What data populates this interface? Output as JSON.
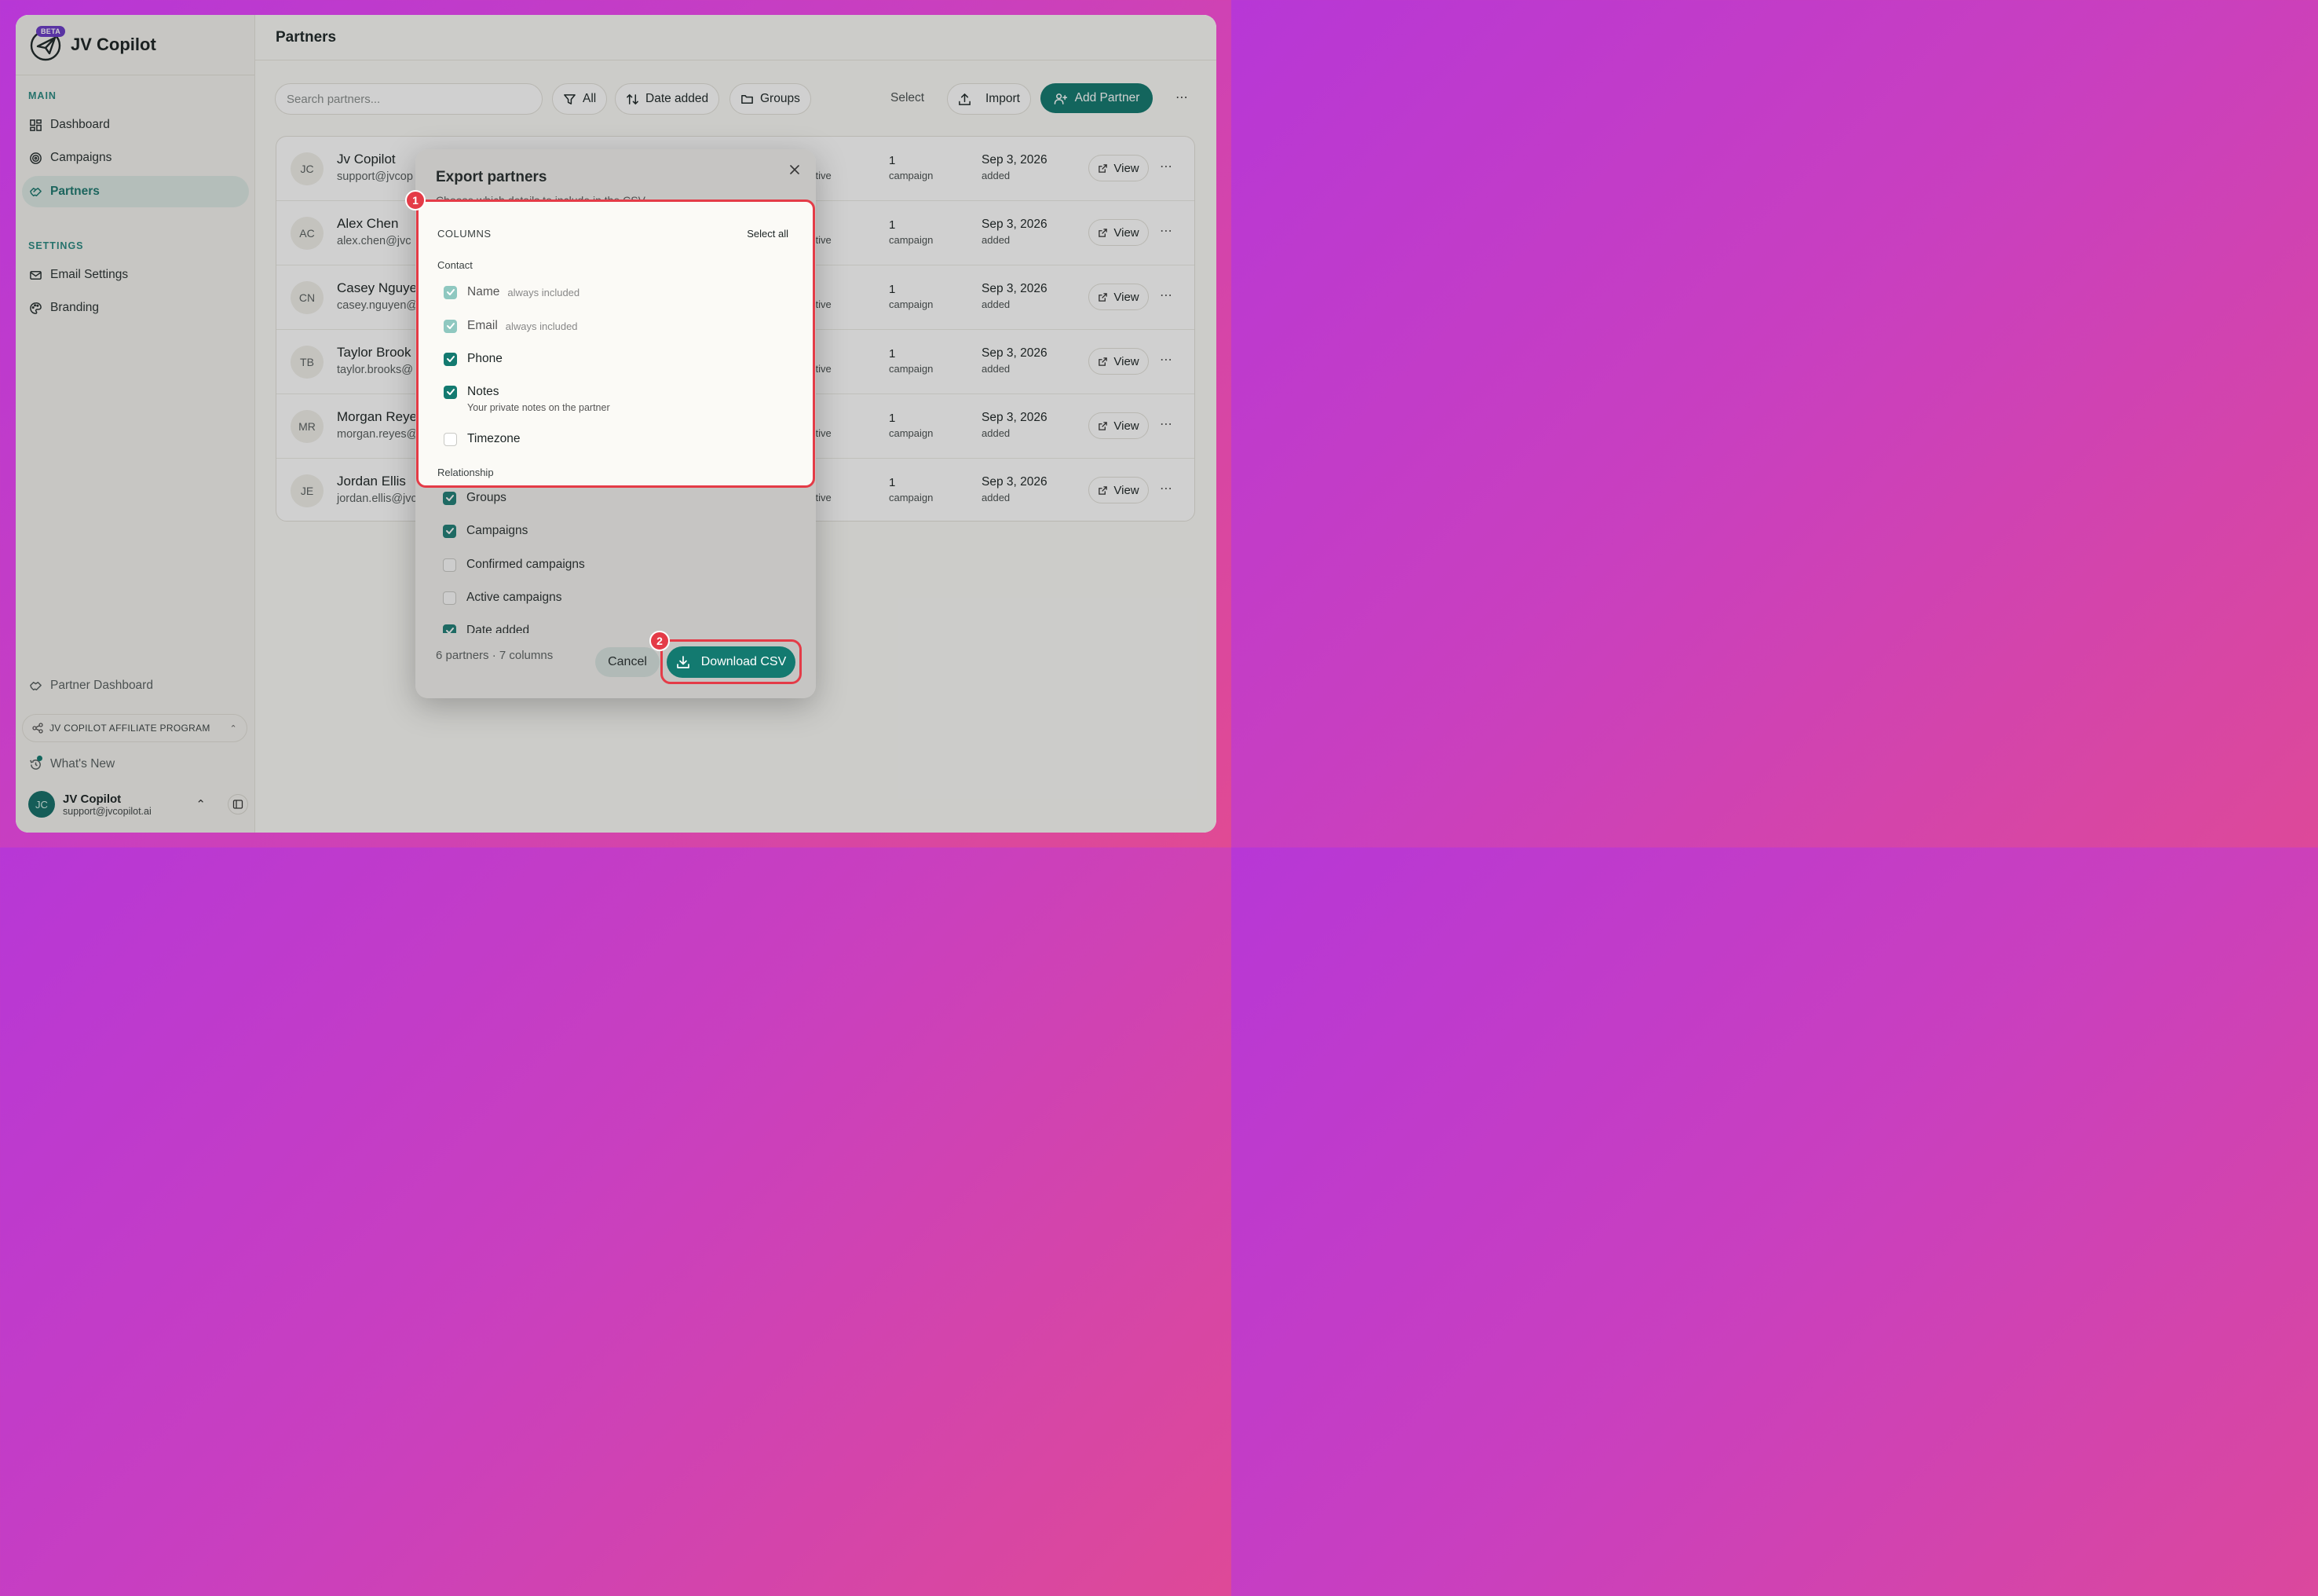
{
  "app": {
    "name": "JV Copilot",
    "badge": "BETA"
  },
  "sidebar": {
    "main_label": "MAIN",
    "settings_label": "SETTINGS",
    "items": [
      {
        "label": "Dashboard",
        "icon": "dashboard-icon"
      },
      {
        "label": "Campaigns",
        "icon": "target-icon"
      },
      {
        "label": "Partners",
        "icon": "handshake-icon"
      },
      {
        "label": "Email Settings",
        "icon": "mail-icon"
      },
      {
        "label": "Branding",
        "icon": "palette-icon"
      }
    ],
    "partner_dashboard": "Partner Dashboard",
    "affiliate": "JV COPILOT AFFILIATE PROGRAM",
    "whats_new": "What's New",
    "user": {
      "initials": "JC",
      "name": "JV Copilot",
      "email": "support@jvcopilot.ai"
    }
  },
  "header": {
    "title": "Partners"
  },
  "toolbar": {
    "search_placeholder": "Search partners...",
    "filter_all": "All",
    "sort": "Date added",
    "groups": "Groups",
    "select": "Select",
    "import": "Import",
    "add_partner": "Add Partner"
  },
  "partners": [
    {
      "initials": "JC",
      "name": "Jv Copilot",
      "email": "support@jvcop",
      "status": "ctive",
      "campaigns": "1",
      "campaigns_label": "campaign",
      "date": "Sep 3, 2026",
      "date_label": "added",
      "view": "View"
    },
    {
      "initials": "AC",
      "name": "Alex Chen",
      "email": "alex.chen@jvc",
      "status": "ctive",
      "campaigns": "1",
      "campaigns_label": "campaign",
      "date": "Sep 3, 2026",
      "date_label": "added",
      "view": "View"
    },
    {
      "initials": "CN",
      "name": "Casey Nguye",
      "email": "casey.nguyen@",
      "status": "ctive",
      "campaigns": "1",
      "campaigns_label": "campaign",
      "date": "Sep 3, 2026",
      "date_label": "added",
      "view": "View"
    },
    {
      "initials": "TB",
      "name": "Taylor Brook",
      "email": "taylor.brooks@",
      "status": "ctive",
      "campaigns": "1",
      "campaigns_label": "campaign",
      "date": "Sep 3, 2026",
      "date_label": "added",
      "view": "View"
    },
    {
      "initials": "MR",
      "name": "Morgan Reye",
      "email": "morgan.reyes@",
      "status": "ctive",
      "campaigns": "1",
      "campaigns_label": "campaign",
      "date": "Sep 3, 2026",
      "date_label": "added",
      "view": "View"
    },
    {
      "initials": "JE",
      "name": "Jordan Ellis",
      "email": "jordan.ellis@jvc",
      "status": "ctive",
      "campaigns": "1",
      "campaigns_label": "campaign",
      "date": "Sep 3, 2026",
      "date_label": "added",
      "view": "View"
    }
  ],
  "modal": {
    "title": "Export partners",
    "subtitle": "Choose which details to include in the CSV",
    "columns_heading": "COLUMNS",
    "select_all": "Select all",
    "contact_heading": "Contact",
    "relationship_heading": "Relationship",
    "contact_fields": [
      {
        "label": "Name",
        "note": "always included",
        "state": "disabled"
      },
      {
        "label": "Email",
        "note": "always included",
        "state": "disabled"
      },
      {
        "label": "Phone",
        "note": "",
        "state": "checked"
      },
      {
        "label": "Notes",
        "note": "Your private notes on the partner",
        "state": "checked"
      },
      {
        "label": "Timezone",
        "note": "",
        "state": "unchecked"
      }
    ],
    "relationship_fields": [
      {
        "label": "Groups",
        "state": "checked"
      },
      {
        "label": "Campaigns",
        "state": "checked"
      },
      {
        "label": "Confirmed campaigns",
        "state": "unchecked"
      },
      {
        "label": "Active campaigns",
        "state": "unchecked"
      },
      {
        "label": "Date added",
        "state": "checked"
      }
    ],
    "summary": "6 partners · 7 columns",
    "cancel": "Cancel",
    "download": "Download CSV"
  },
  "annotations": {
    "badge_1": "1",
    "badge_2": "2"
  },
  "colors": {
    "accent": "#137a70",
    "highlight": "#e43b47",
    "sidebar_section": "#2b8a82"
  }
}
